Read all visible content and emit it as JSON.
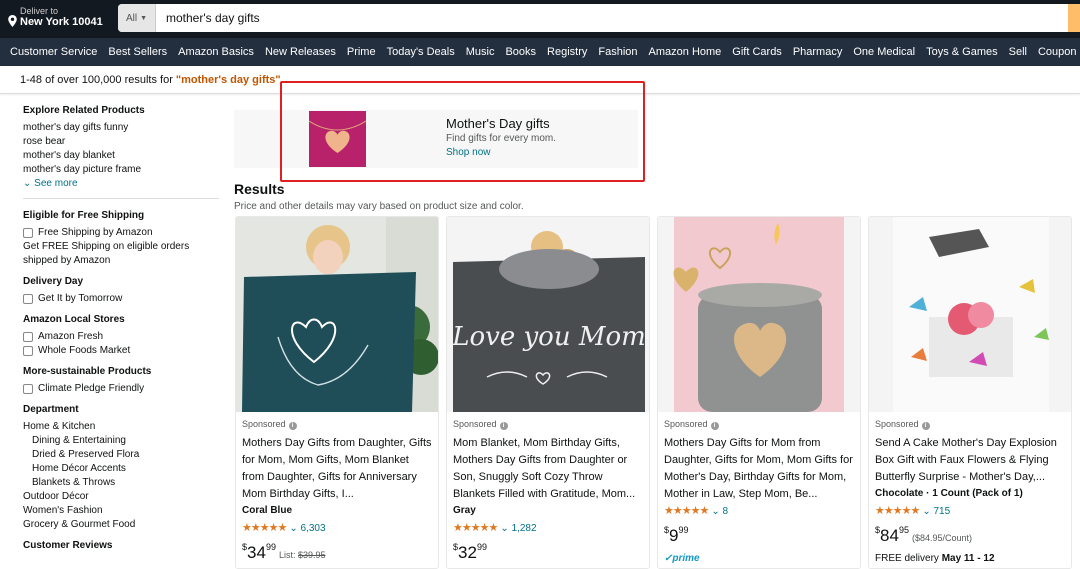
{
  "header": {
    "deliver_line1": "Deliver to",
    "deliver_line2": "New York 10041",
    "search_category": "All",
    "search_value": "mother's day gifts"
  },
  "nav_items": [
    "Customer Service",
    "Best Sellers",
    "Amazon Basics",
    "New Releases",
    "Prime",
    "Today's Deals",
    "Music",
    "Books",
    "Registry",
    "Fashion",
    "Amazon Home",
    "Gift Cards",
    "Pharmacy",
    "One Medical",
    "Toys & Games",
    "Sell",
    "Coupon"
  ],
  "results_bar": {
    "count_text": "1-48 of over 100,000 results for",
    "query": "\"mother's day gifts\""
  },
  "sidebar": {
    "related_title": "Explore Related Products",
    "related": [
      "mother's day gifts funny",
      "rose bear",
      "mother's day blanket",
      "mother's day picture frame"
    ],
    "see_more": "See more",
    "free_shipping_title": "Eligible for Free Shipping",
    "free_shipping_option": "Free Shipping by Amazon",
    "free_shipping_note": "Get FREE Shipping on eligible orders shipped by Amazon",
    "delivery_title": "Delivery Day",
    "delivery_option": "Get It by Tomorrow",
    "local_title": "Amazon Local Stores",
    "local_options": [
      "Amazon Fresh",
      "Whole Foods Market"
    ],
    "sustain_title": "More-sustainable Products",
    "sustain_option": "Climate Pledge Friendly",
    "dept_title": "Department",
    "dept_main": "Home & Kitchen",
    "dept_sub": [
      "Dining & Entertaining",
      "Dried & Preserved Flora",
      "Home Décor Accents",
      "Blankets & Throws"
    ],
    "dept_other": [
      "Outdoor Décor",
      "Women's Fashion",
      "Grocery & Gourmet Food"
    ],
    "reviews_title": "Customer Reviews"
  },
  "banner": {
    "title": "Mother's Day gifts",
    "subtitle": "Find gifts for every mom.",
    "link": "Shop now"
  },
  "results": {
    "heading": "Results",
    "subheading": "Price and other details may vary based on product size and color."
  },
  "products": [
    {
      "sponsored": "Sponsored",
      "title": "Mothers Day Gifts from Daughter, Gifts for Mom, Mom Gifts, Mom Blanket from Daughter, Gifts for Anniversary Mom Birthday Gifts, I...",
      "variant": "Coral Blue",
      "rating": 4.5,
      "stars": "★★★★★",
      "reviews": "6,303",
      "price_whole": "34",
      "price_frac": "99",
      "list_label": "List:",
      "list_price": "$39.95"
    },
    {
      "sponsored": "Sponsored",
      "title": "Mom Blanket, Mom Birthday Gifts, Mothers Day Gifts from Daughter or Son, Snuggly Soft Cozy Throw Blankets Filled with Gratitude, Mom...",
      "variant": "Gray",
      "rating": 4.5,
      "stars": "★★★★★",
      "reviews": "1,282",
      "price_whole": "32",
      "price_frac": "99"
    },
    {
      "sponsored": "Sponsored",
      "title": "Mothers Day Gifts for Mom from Daughter, Gifts for Mom, Mom Gifts for Mother's Day, Birthday Gifts for Mom, Mother in Law, Step Mom, Be...",
      "rating": 4.5,
      "stars": "★★★★★",
      "reviews": "8",
      "price_whole": "9",
      "price_frac": "99",
      "prime": "prime"
    },
    {
      "sponsored": "Sponsored",
      "title": "Send A Cake Mother's Day Explosion Box Gift with Faux Flowers & Flying Butterfly Surprise - Mother's Day,...",
      "variant": "Chocolate · 1 Count (Pack of 1)",
      "rating": 4.5,
      "stars": "★★★★★",
      "reviews": "715",
      "price_whole": "84",
      "price_frac": "95",
      "unit_price": "($84.95/Count)",
      "delivery_label": "FREE delivery",
      "delivery_date": "May 11 - 12"
    }
  ],
  "colors": {
    "topbar": "#131921",
    "nav": "#232f3e",
    "link": "#007185",
    "query": "#c45500",
    "star": "#de7921",
    "highlight": "#e02020"
  }
}
